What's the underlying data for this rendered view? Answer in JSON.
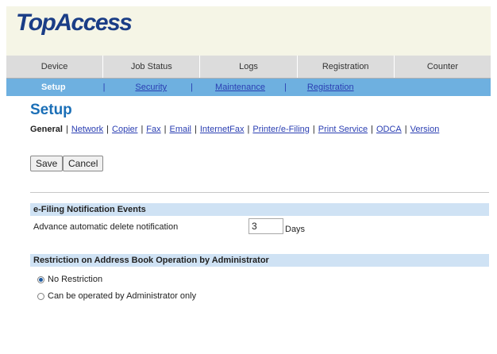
{
  "app": {
    "logo": "TopAccess"
  },
  "main_tabs": [
    "Device",
    "Job Status",
    "Logs",
    "Registration",
    "Counter"
  ],
  "sub_nav": {
    "active": "Setup",
    "items": [
      "Security",
      "Maintenance",
      "Registration"
    ],
    "separator": "|"
  },
  "page": {
    "title": "Setup"
  },
  "setup_nav": {
    "current": "General",
    "items": [
      "Network",
      "Copier",
      "Fax",
      "Email",
      "InternetFax",
      "Printer/e-Filing",
      "Print Service",
      "ODCA",
      "Version"
    ]
  },
  "buttons": {
    "save": "Save",
    "cancel": "Cancel"
  },
  "efiling": {
    "heading": "e-Filing Notification Events",
    "label": "Advance automatic delete notification",
    "value": "3",
    "unit": "Days"
  },
  "restriction": {
    "heading": "Restriction on Address Book Operation by Administrator",
    "options": [
      "No Restriction",
      "Can be operated by Administrator only"
    ],
    "selected": "No Restriction"
  },
  "colors": {
    "logo": "#1a3d86",
    "subbar": "#6eb0e0",
    "title": "#1b6fb7",
    "section_bg": "#cfe2f4",
    "link": "#2a3eb2"
  }
}
